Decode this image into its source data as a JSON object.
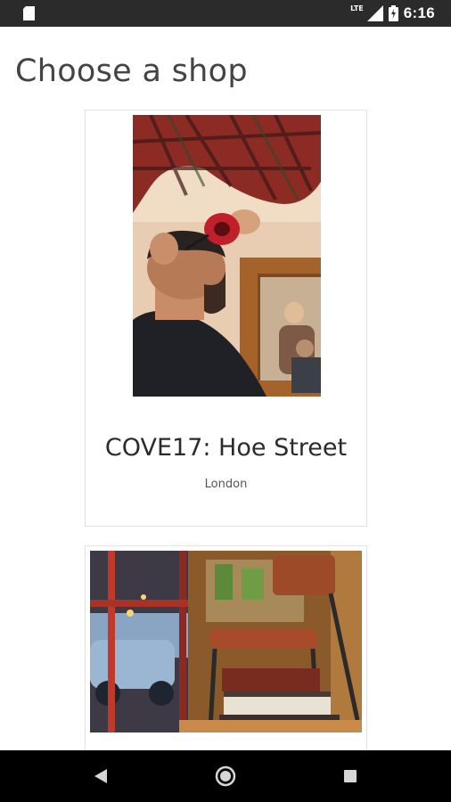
{
  "status_bar": {
    "network": "LTE",
    "time": "6:16",
    "icons": [
      "sd-card-icon",
      "signal-icon",
      "battery-charging-icon"
    ]
  },
  "page": {
    "title": "Choose a shop"
  },
  "shops": [
    {
      "name": "COVE17: Hoe Street",
      "city": "London",
      "image": "barber-cutting-hair-photo"
    },
    {
      "image": "barbershop-interior-chair-books-photo"
    }
  ],
  "nav_bar": {
    "icons": [
      "back-icon",
      "home-icon",
      "recents-icon"
    ]
  }
}
